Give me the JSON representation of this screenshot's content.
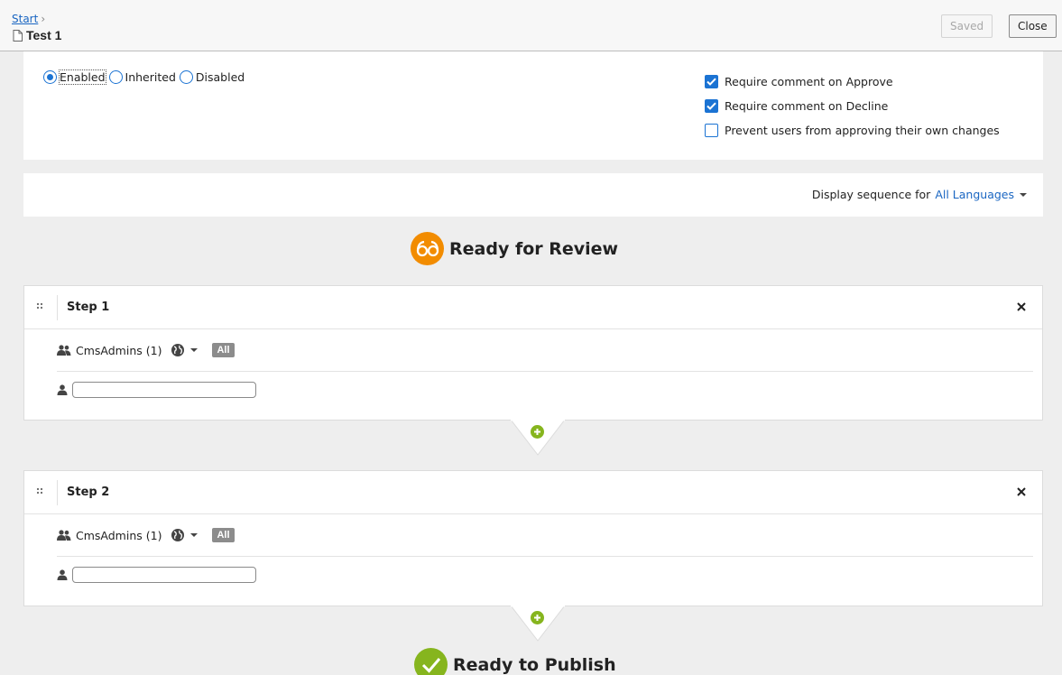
{
  "header": {
    "breadcrumb_start": "Start",
    "breadcrumb_sep": "›",
    "title": "Test 1",
    "saved_label": "Saved",
    "close_label": "Close"
  },
  "settings": {
    "radios": [
      {
        "label": "Enabled",
        "selected": true
      },
      {
        "label": "Inherited",
        "selected": false
      },
      {
        "label": "Disabled",
        "selected": false
      }
    ],
    "checkboxes": [
      {
        "label": "Require comment on Approve",
        "checked": true
      },
      {
        "label": "Require comment on Decline",
        "checked": true
      },
      {
        "label": "Prevent users from approving their own changes",
        "checked": false
      }
    ]
  },
  "sequence": {
    "prefix": "Display sequence for",
    "language": "All Languages"
  },
  "stages": {
    "review": "Ready for Review",
    "publish": "Ready to Publish"
  },
  "steps": [
    {
      "title": "Step 1",
      "group": "CmsAdmins (1)",
      "badge": "All",
      "user_value": ""
    },
    {
      "title": "Step 2",
      "group": "CmsAdmins (1)",
      "badge": "All",
      "user_value": ""
    }
  ],
  "colors": {
    "accent_blue": "#1b73d3",
    "review_orange": "#f28c00",
    "publish_green": "#86b51e"
  }
}
